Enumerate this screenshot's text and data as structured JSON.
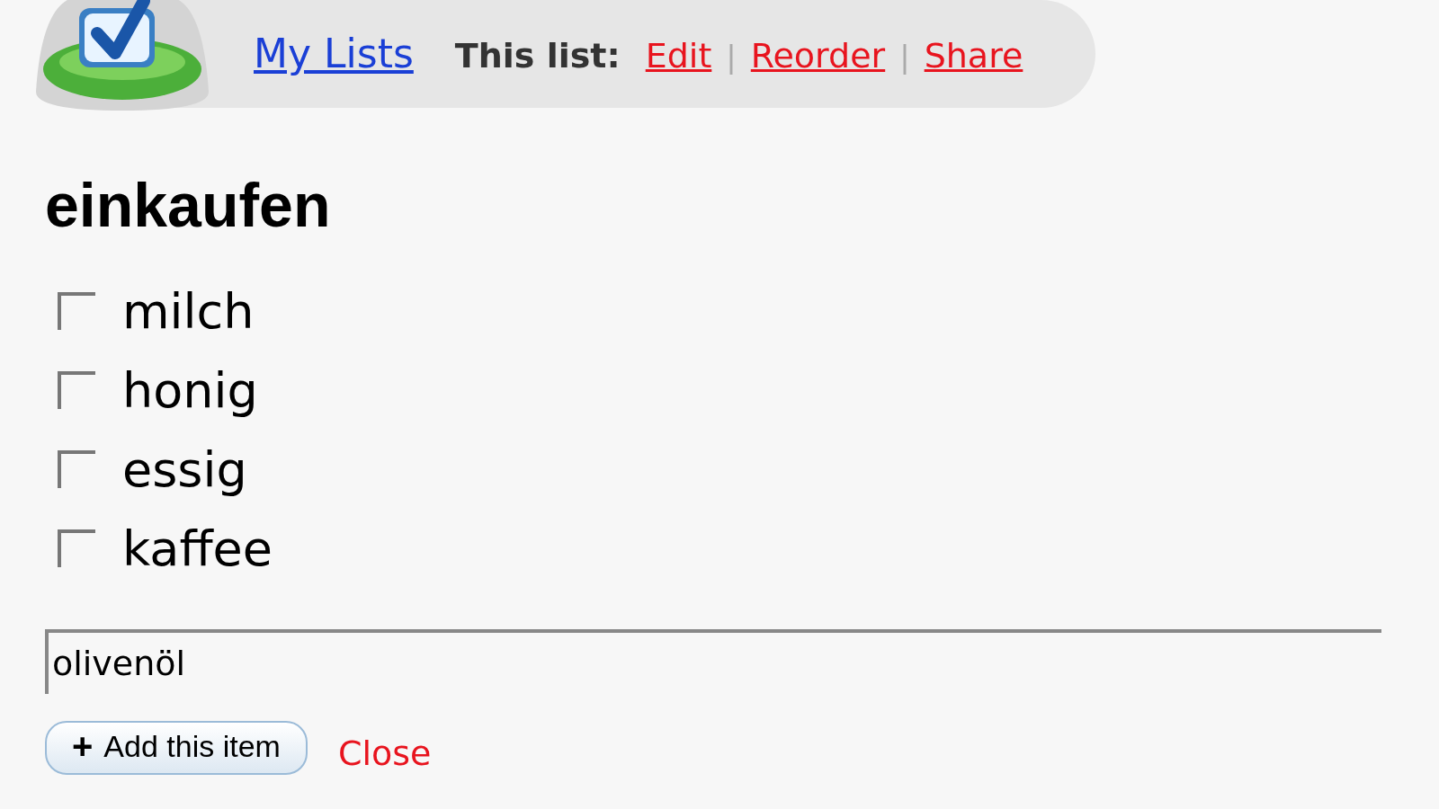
{
  "header": {
    "my_lists": "My Lists",
    "this_list_label": "This list:",
    "actions": [
      {
        "label": "Edit"
      },
      {
        "label": "Reorder"
      },
      {
        "label": "Share"
      }
    ],
    "separator": "|"
  },
  "list_title": "einkaufen",
  "items": [
    {
      "label": "milch",
      "checked": false
    },
    {
      "label": "honig",
      "checked": false
    },
    {
      "label": "essig",
      "checked": false
    },
    {
      "label": "kaffee",
      "checked": false
    }
  ],
  "new_item": {
    "value": "olivenöl"
  },
  "add_button": {
    "icon": "+",
    "label": "Add this item"
  },
  "close_link": "Close"
}
